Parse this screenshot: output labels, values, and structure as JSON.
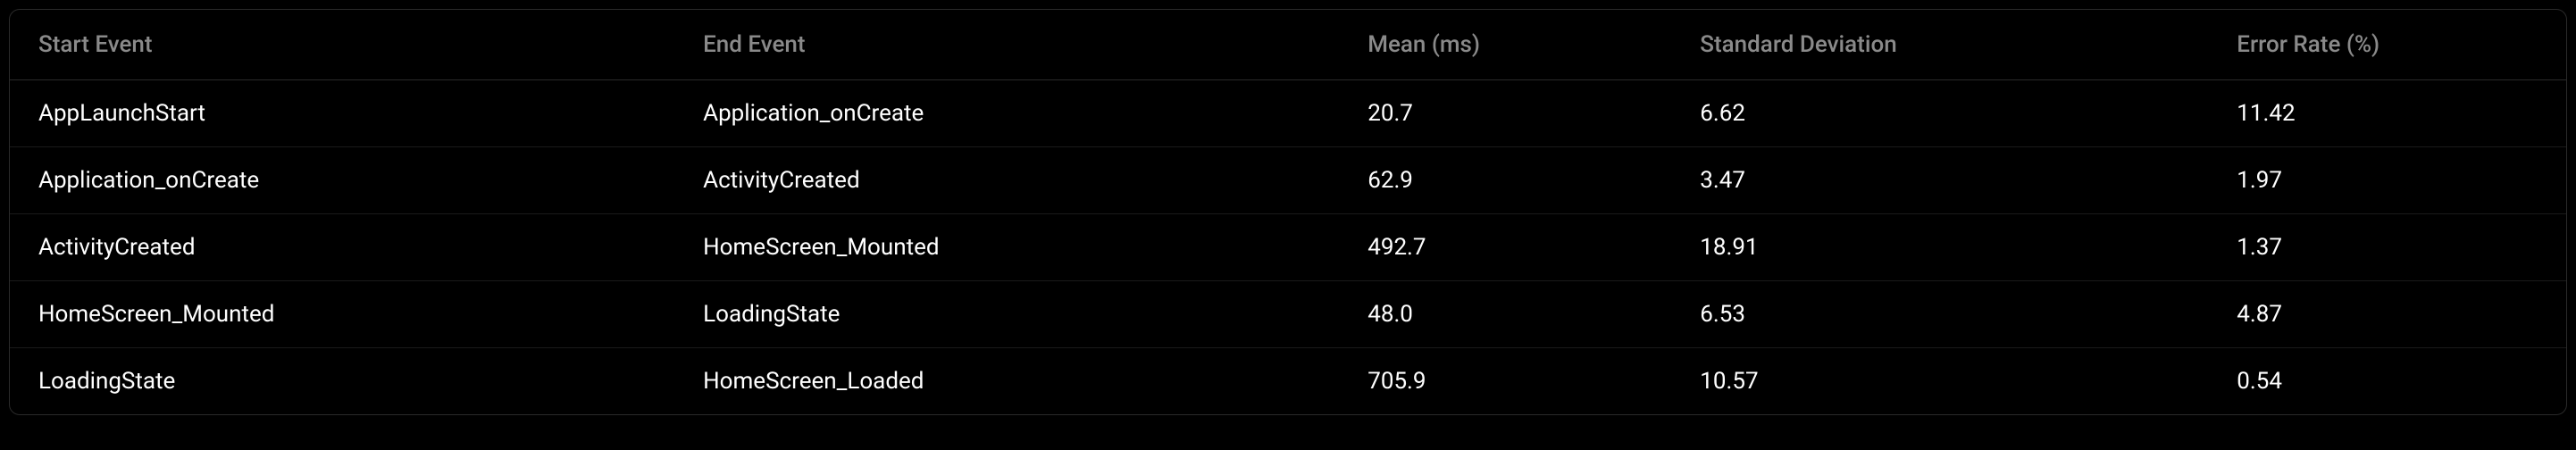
{
  "table": {
    "headers": {
      "start_event": "Start Event",
      "end_event": "End Event",
      "mean": "Mean (ms)",
      "std_dev": "Standard Deviation",
      "error_rate": "Error Rate (%)"
    },
    "rows": [
      {
        "start_event": "AppLaunchStart",
        "end_event": "Application_onCreate",
        "mean": "20.7",
        "std_dev": "6.62",
        "error_rate": "11.42"
      },
      {
        "start_event": "Application_onCreate",
        "end_event": "ActivityCreated",
        "mean": "62.9",
        "std_dev": "3.47",
        "error_rate": "1.97"
      },
      {
        "start_event": "ActivityCreated",
        "end_event": "HomeScreen_Mounted",
        "mean": "492.7",
        "std_dev": "18.91",
        "error_rate": "1.37"
      },
      {
        "start_event": "HomeScreen_Mounted",
        "end_event": "LoadingState",
        "mean": "48.0",
        "std_dev": "6.53",
        "error_rate": "4.87"
      },
      {
        "start_event": "LoadingState",
        "end_event": "HomeScreen_Loaded",
        "mean": "705.9",
        "std_dev": "10.57",
        "error_rate": "0.54"
      }
    ]
  }
}
